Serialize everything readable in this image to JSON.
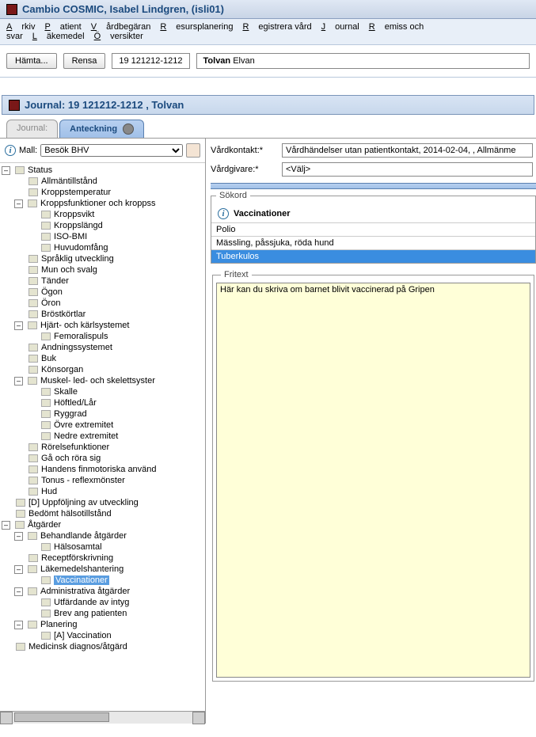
{
  "app": {
    "title": "Cambio COSMIC, Isabel Lindgren, (isli01)"
  },
  "menu": {
    "items": [
      "Arkiv",
      "Patient",
      "Vårdbegäran",
      "Resursplanering",
      "Registrera vård",
      "Journal",
      "Remiss och svar",
      "Läkemedel",
      "Översikter"
    ]
  },
  "toolbar": {
    "fetch": "Hämta...",
    "clear": "Rensa",
    "patient_id": "19 121212-1212",
    "patient_name_bold": "Tolvan",
    "patient_name_rest": " Elvan"
  },
  "subheader": {
    "title": "Journal: 19 121212-1212 , Tolvan"
  },
  "tabs": {
    "journal": "Journal:",
    "anteckning": "Anteckning"
  },
  "mall": {
    "label": "Mall:",
    "value": "Besök BHV"
  },
  "form": {
    "vardkontakt_label": "Vårdkontakt:*",
    "vardkontakt_value": "Vårdhändelser utan patientkontakt, 2014-02-04, , Allmänme",
    "vardgivare_label": "Vårdgivare:*",
    "vardgivare_value": "<Välj>"
  },
  "sokord": {
    "legend": "Sökord",
    "header": "Vaccinationer",
    "rows": [
      "Polio",
      "Mässling, påssjuka, röda hund",
      "Tuberkulos"
    ],
    "selected_index": 2
  },
  "fritext": {
    "legend": "Fritext",
    "value": "Här kan du skriva om barnet blivit vaccinerad på Gripen"
  },
  "tree": [
    {
      "level": 0,
      "toggle": "–",
      "icon": "status",
      "label": "Status"
    },
    {
      "level": 1,
      "label": "Allmäntillstånd"
    },
    {
      "level": 1,
      "label": "Kroppstemperatur"
    },
    {
      "level": 1,
      "toggle": "–",
      "label": "Kroppsfunktioner och kroppss"
    },
    {
      "level": 2,
      "label": "Kroppsvikt"
    },
    {
      "level": 2,
      "label": "Kroppslängd"
    },
    {
      "level": 2,
      "label": "ISO-BMI"
    },
    {
      "level": 2,
      "label": "Huvudomfång"
    },
    {
      "level": 1,
      "label": "Språklig utveckling"
    },
    {
      "level": 1,
      "label": "Mun och svalg"
    },
    {
      "level": 1,
      "label": "Tänder"
    },
    {
      "level": 1,
      "label": "Ögon"
    },
    {
      "level": 1,
      "label": "Öron"
    },
    {
      "level": 1,
      "label": "Bröstkörtlar"
    },
    {
      "level": 1,
      "toggle": "–",
      "label": "Hjärt- och kärlsystemet"
    },
    {
      "level": 2,
      "label": "Femoralispuls"
    },
    {
      "level": 1,
      "label": "Andningssystemet"
    },
    {
      "level": 1,
      "label": "Buk"
    },
    {
      "level": 1,
      "label": "Könsorgan"
    },
    {
      "level": 1,
      "toggle": "–",
      "label": "Muskel- led- och skelettsyster"
    },
    {
      "level": 2,
      "label": "Skalle"
    },
    {
      "level": 2,
      "label": "Höftled/Lår"
    },
    {
      "level": 2,
      "label": "Ryggrad"
    },
    {
      "level": 2,
      "label": "Övre extremitet"
    },
    {
      "level": 2,
      "label": "Nedre extremitet"
    },
    {
      "level": 1,
      "label": "Rörelsefunktioner"
    },
    {
      "level": 1,
      "label": "Gå och röra sig"
    },
    {
      "level": 1,
      "label": "Handens finmotoriska använd"
    },
    {
      "level": 1,
      "label": "Tonus - reflexmönster"
    },
    {
      "level": 1,
      "label": "Hud"
    },
    {
      "level": 0,
      "label": "[D] Uppföljning av utveckling"
    },
    {
      "level": 0,
      "label": "Bedömt hälsotillstånd"
    },
    {
      "level": 0,
      "toggle": "–",
      "icon": "lock",
      "label": "Åtgärder"
    },
    {
      "level": 1,
      "toggle": "–",
      "label": "Behandlande åtgärder"
    },
    {
      "level": 2,
      "label": "Hälsosamtal"
    },
    {
      "level": 1,
      "label": "Receptförskrivning"
    },
    {
      "level": 1,
      "toggle": "–",
      "label": "Läkemedelshantering"
    },
    {
      "level": 2,
      "label": "Vaccinationer",
      "selected": true
    },
    {
      "level": 1,
      "toggle": "–",
      "label": "Administrativa åtgärder"
    },
    {
      "level": 2,
      "label": "Utfärdande av intyg"
    },
    {
      "level": 2,
      "label": "Brev ang patienten"
    },
    {
      "level": 1,
      "toggle": "–",
      "label": "Planering"
    },
    {
      "level": 2,
      "label": "[A] Vaccination"
    },
    {
      "level": 0,
      "label": "Medicinsk diagnos/åtgärd"
    }
  ]
}
